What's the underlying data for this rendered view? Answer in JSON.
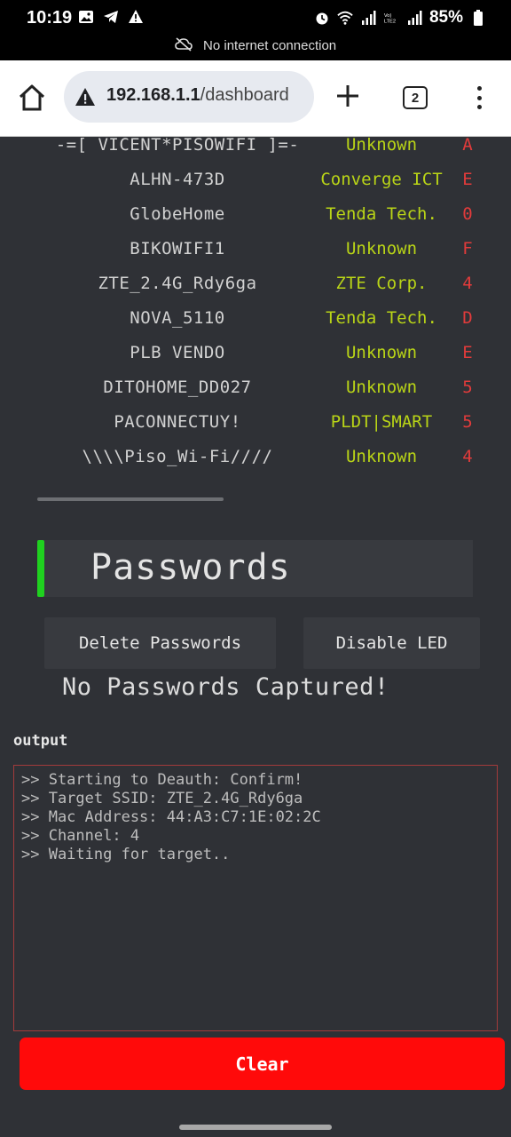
{
  "status_bar": {
    "time": "10:19",
    "battery": "85%",
    "network_notice": "No internet connection"
  },
  "browser": {
    "url_host": "192.168.1.1",
    "url_path": "/dashboard",
    "tab_count": "2"
  },
  "networks": [
    {
      "ssid": "-=[ VICENT*PISOWIFI ]=-",
      "vendor": "Unknown",
      "channel": "A"
    },
    {
      "ssid": "ALHN-473D",
      "vendor": "Converge ICT",
      "channel": "E"
    },
    {
      "ssid": "GlobeHome",
      "vendor": "Tenda Tech.",
      "channel": "0"
    },
    {
      "ssid": "BIKOWIFI1",
      "vendor": "Unknown",
      "channel": "F"
    },
    {
      "ssid": "ZTE_2.4G_Rdy6ga",
      "vendor": "ZTE Corp.",
      "channel": "4"
    },
    {
      "ssid": "NOVA_5110",
      "vendor": "Tenda Tech.",
      "channel": "D"
    },
    {
      "ssid": "PLB VENDO",
      "vendor": "Unknown",
      "channel": "E"
    },
    {
      "ssid": "DITOHOME_DD027",
      "vendor": "Unknown",
      "channel": "5"
    },
    {
      "ssid": "PACONNECTUY!",
      "vendor": "PLDT|SMART",
      "channel": "5"
    },
    {
      "ssid": "\\\\\\\\Piso_Wi-Fi////",
      "vendor": "Unknown",
      "channel": "4"
    }
  ],
  "passwords": {
    "title": "Passwords",
    "delete_label": "Delete Passwords",
    "led_label": "Disable LED",
    "empty_message": "No Passwords Captured!"
  },
  "output": {
    "label": "output",
    "lines": [
      ">> Starting to Deauth: Confirm!",
      ">> Target SSID: ZTE_2.4G_Rdy6ga",
      ">> Mac Address: 44:A3:C7:1E:02:2C",
      ">> Channel: 4",
      ">> Waiting for target.."
    ],
    "clear_label": "Clear"
  },
  "colors": {
    "background": "#2f3136",
    "vendor": "#b9d417",
    "channel": "#e23b3b",
    "accent": "#1fd11f",
    "clear_button": "#ff0a0a"
  }
}
